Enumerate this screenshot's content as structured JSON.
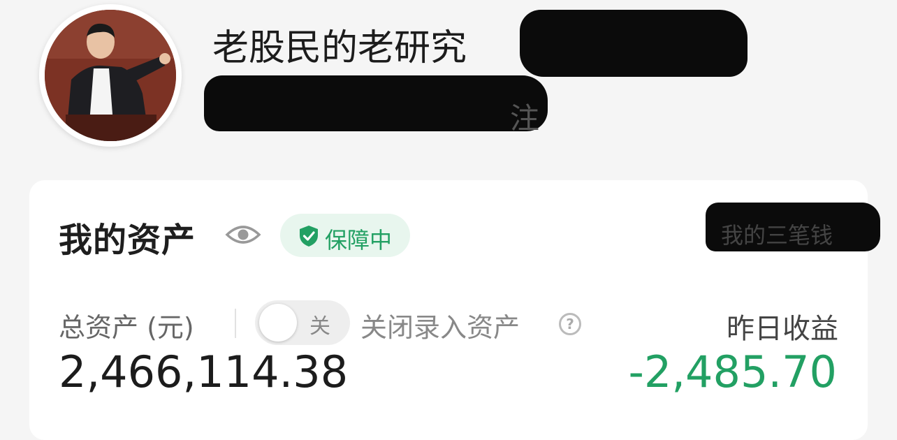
{
  "profile": {
    "username": "老股民的老研究",
    "follow_suffix": "注"
  },
  "assets": {
    "title": "我的资产",
    "badge_label": "保障中",
    "three_money_link": "我的三笔钱",
    "total_label": "总资产 (元)",
    "toggle_text": "关",
    "toggle_desc": "关闭录入资产",
    "help_glyph": "?",
    "total_value": "2,466,114.38",
    "yesterday_label": "昨日收益",
    "yesterday_value": "-2,485.70"
  },
  "icons": {
    "eye": "eye-icon",
    "shield": "shield-check-icon",
    "help": "question-circle-icon"
  },
  "colors": {
    "accent_green": "#22a063",
    "badge_bg": "#e8f6ee",
    "card_bg": "#ffffff",
    "page_bg": "#f5f5f5"
  }
}
